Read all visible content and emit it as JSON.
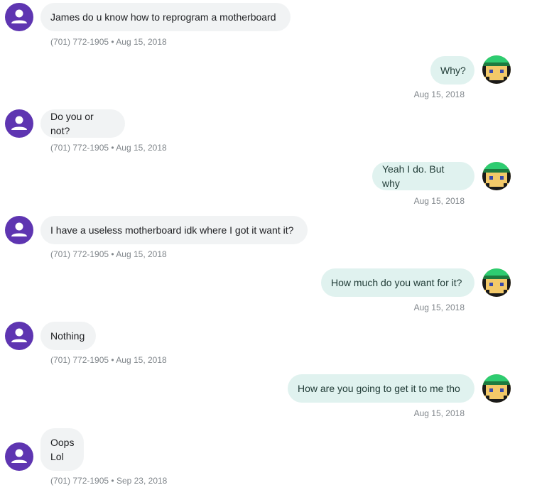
{
  "contact": {
    "phone": "(701) 772-1905",
    "separator": " • "
  },
  "colors": {
    "incoming_avatar": "#5e35b1",
    "incoming_bubble": "#f1f3f4",
    "outgoing_bubble": "#e0f2ef",
    "meta_text": "#80868b"
  },
  "messages": [
    {
      "direction": "incoming",
      "text": "James do u know how to reprogram a motherboard",
      "date": "Aug 15, 2018"
    },
    {
      "direction": "outgoing",
      "text": "Why?",
      "date": "Aug 15, 2018"
    },
    {
      "direction": "incoming",
      "text": "Do you or not?",
      "date": "Aug 15, 2018"
    },
    {
      "direction": "outgoing",
      "text": "Yeah I do. But why",
      "date": "Aug 15, 2018"
    },
    {
      "direction": "incoming",
      "text": "I have a useless motherboard idk where I got it want it?",
      "date": "Aug 15, 2018"
    },
    {
      "direction": "outgoing",
      "text": "How much do you want for it?",
      "date": "Aug 15, 2018"
    },
    {
      "direction": "incoming",
      "text": "Nothing",
      "date": "Aug 15, 2018"
    },
    {
      "direction": "outgoing",
      "text": "How are you going to get it to me tho",
      "date": "Aug 15, 2018"
    },
    {
      "direction": "incoming",
      "text": "Oops\nLol",
      "date": "Sep 23, 2018"
    }
  ],
  "icons": {
    "incoming_avatar": "person-avatar-icon",
    "outgoing_avatar": "pixel-face-avatar-icon"
  }
}
